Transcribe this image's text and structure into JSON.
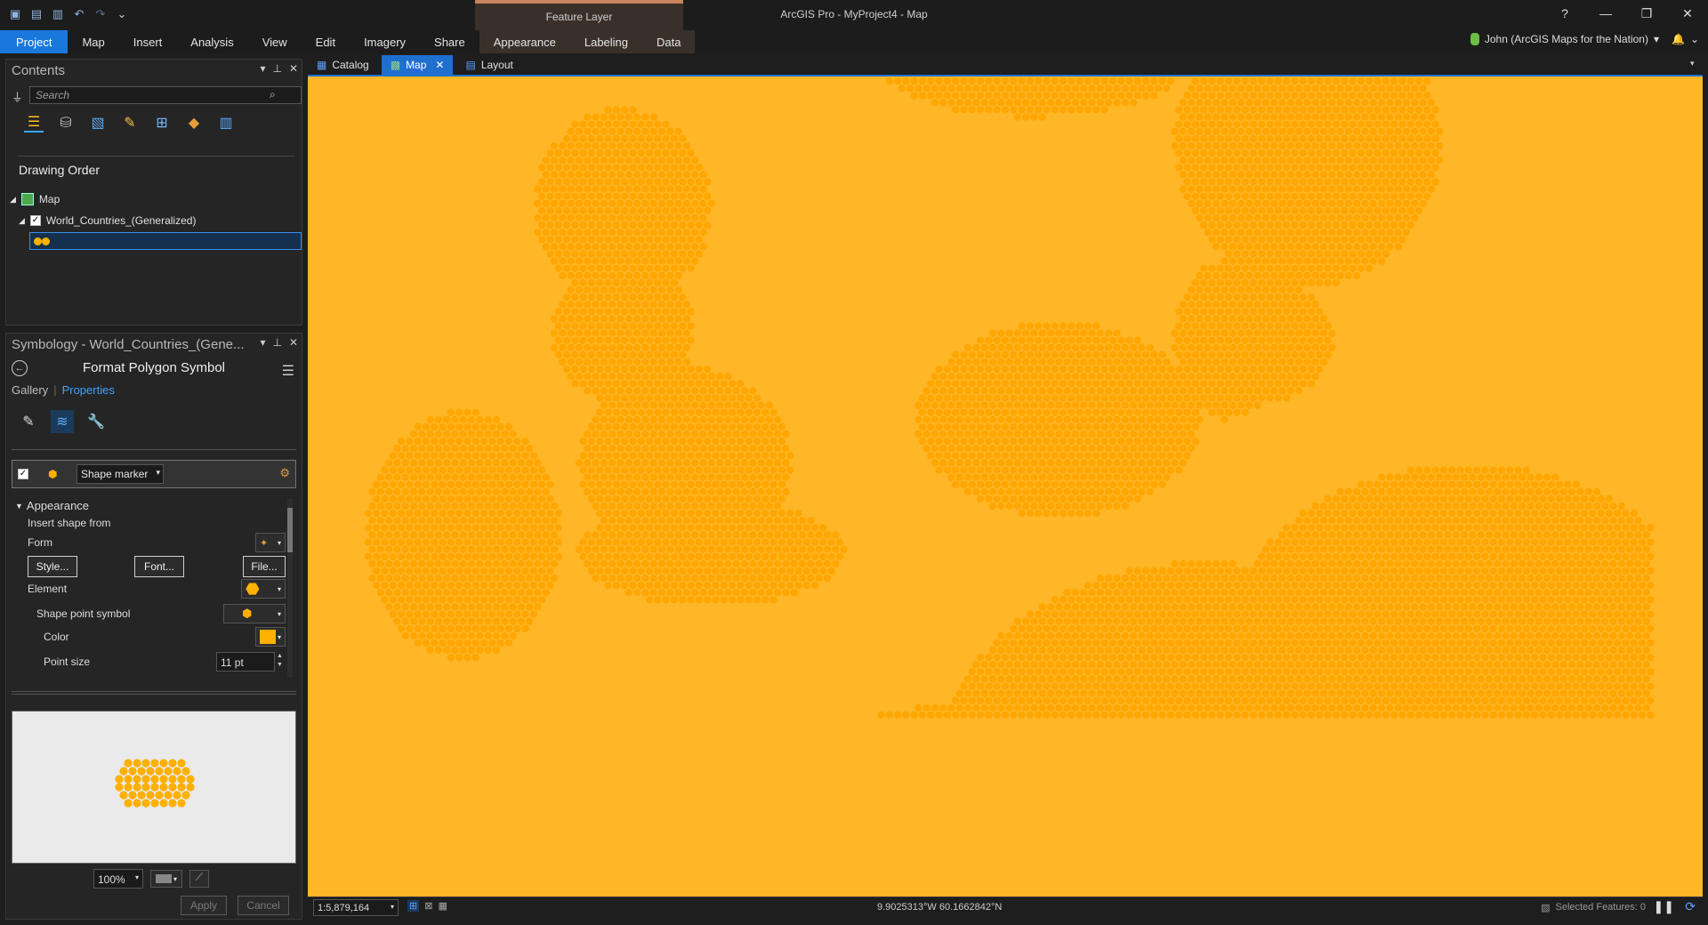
{
  "app": {
    "title": "ArcGIS Pro - MyProject4 - Map",
    "context_tab_group": "Feature Layer",
    "user": "John (ArcGIS Maps for the Nation)",
    "help": "?"
  },
  "ribbon": {
    "tabs": [
      "Project",
      "Map",
      "Insert",
      "Analysis",
      "View",
      "Edit",
      "Imagery",
      "Share",
      "Appearance",
      "Labeling",
      "Data"
    ],
    "active_tab": "Project"
  },
  "contents": {
    "title": "Contents",
    "search_placeholder": "Search",
    "section": "Drawing Order",
    "map_label": "Map",
    "layer_label": "World_Countries_(Generalized)",
    "tool_icons": [
      "list-by-drawing-order-icon",
      "list-by-source-icon",
      "list-by-selection-icon",
      "list-by-editing-icon",
      "list-by-snapping-icon",
      "list-by-labeling-icon",
      "list-by-charts-icon"
    ]
  },
  "symbology": {
    "title": "Symbology - World_Countries_(Gene...",
    "subtitle": "Format Polygon Symbol",
    "gallery": "Gallery",
    "properties": "Properties",
    "layer_type": "Shape marker",
    "appearance": "Appearance",
    "insert_shape_from": "Insert shape from",
    "form": "Form",
    "style_btn": "Style...",
    "font_btn": "Font...",
    "file_btn": "File...",
    "element": "Element",
    "shape_point_symbol": "Shape point symbol",
    "color": "Color",
    "color_value": "#ffb000",
    "point_size": "Point size",
    "point_size_value": "11 pt",
    "zoom": "100%",
    "apply": "Apply",
    "cancel": "Cancel"
  },
  "views": {
    "tabs": [
      "Catalog",
      "Map",
      "Layout"
    ],
    "active": "Map"
  },
  "map": {
    "background": "#ffb627",
    "marker_color": "#ffa600"
  },
  "status": {
    "scale": "1:5,879,164",
    "coords": "9.9025313°W 60.1662842°N",
    "selected": "Selected Features: 0"
  }
}
